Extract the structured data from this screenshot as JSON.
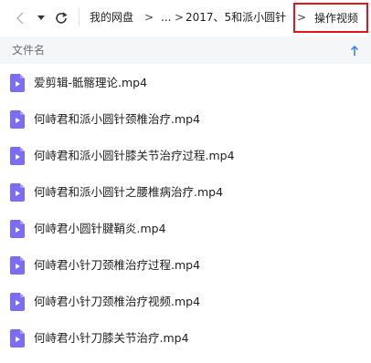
{
  "nav": {
    "back_icon": "chevron-left-icon",
    "dropdown_icon": "caret-down-icon",
    "refresh_icon": "refresh-icon",
    "breadcrumbs": [
      "我的网盘",
      "...",
      "2017、5和派小圆针"
    ],
    "separator": ">",
    "current": "操作视频",
    "highlight_color": "#e4151b"
  },
  "list_header": {
    "column_name": "文件名",
    "sort_icon": "sort-ascending-icon",
    "sort_color": "#2f7cf6"
  },
  "file_icon": {
    "name": "video-file-icon",
    "color": "#7b6cf6"
  },
  "files": [
    {
      "name": "爱剪辑-骶髂理论.mp4"
    },
    {
      "name": "何峙君和派小圆针颈椎治疗.mp4"
    },
    {
      "name": "何峙君和派小圆针膝关节治疗过程.mp4"
    },
    {
      "name": "何峙君和派小圆针之腰椎病治疗.mp4"
    },
    {
      "name": "何峙君小圆针腱鞘炎.mp4"
    },
    {
      "name": "何峙君小针刀颈椎治疗过程.mp4"
    },
    {
      "name": "何峙君小针刀颈椎治疗视频.mp4"
    },
    {
      "name": "何峙君小针刀膝关节治疗.mp4"
    }
  ]
}
